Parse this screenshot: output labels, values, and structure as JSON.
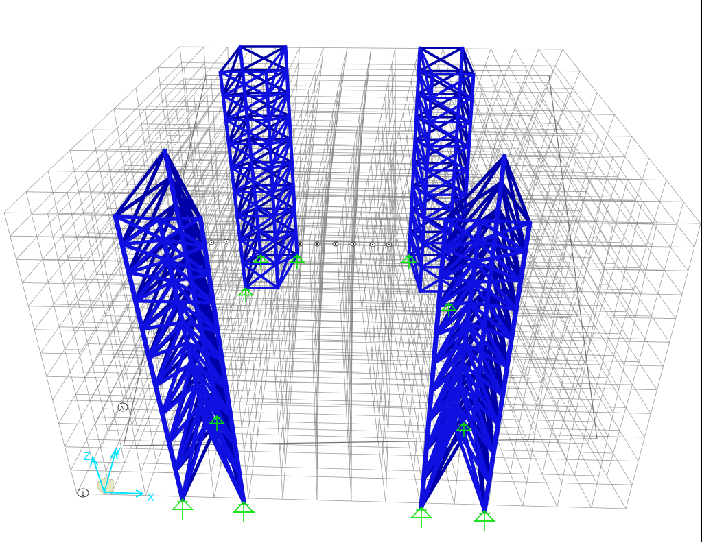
{
  "app": {
    "view": "3-D View"
  },
  "axis_triad": {
    "x_label": "X",
    "y_label": "Y",
    "z_label": "Z",
    "color": "#00e5ff"
  },
  "grid_bubbles": {
    "front_left_label": "1",
    "left_side_label": "A"
  },
  "colors": {
    "grid_line": "#8c8c8c",
    "frame_member": "#1010e0",
    "frame_member_dark": "#0000a8",
    "support": "#00e000",
    "background": "#ffffff"
  },
  "model": {
    "towers": [
      "front-left-tower",
      "back-left-tower",
      "back-right-tower",
      "front-right-tower"
    ],
    "supports": "pinned"
  }
}
